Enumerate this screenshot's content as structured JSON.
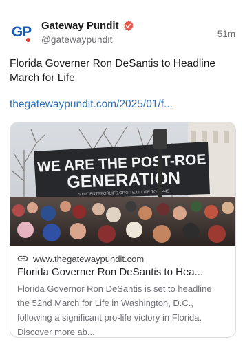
{
  "post": {
    "avatar_text": "GP",
    "display_name": "Gateway Pundit",
    "handle": "@gatewaypundit",
    "time": "51m",
    "text": "Florida Governer Ron DeSantis to Headline March for Life",
    "link": "thegatewaypundit.com/2025/01/f..."
  },
  "card": {
    "banner_line1": "WE ARE THE POST-ROE",
    "banner_line2": "GENERATION",
    "banner_small": "STUDENTSFORLIFE.ORG  TEXT LIFE TO 53445",
    "domain": "www.thegatewaypundit.com",
    "title": "Florida Governer Ron DeSantis to Hea...",
    "description": "Florida Governor Ron DeSantis is set to headline the 52nd March for Life in Washington, D.C., following a significant pro-life victory in Florida. Discover more ab..."
  },
  "colors": {
    "link": "#2f6fb3",
    "verified_badge": "#e8554a",
    "avatar_blue": "#1a5bb5"
  },
  "icons": {
    "verified": "verified-badge-icon",
    "link": "link-icon"
  }
}
